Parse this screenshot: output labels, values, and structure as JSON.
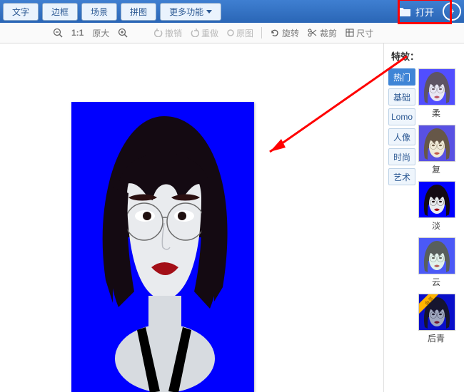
{
  "nav": {
    "tabs": [
      "文字",
      "边框",
      "场景",
      "拼图"
    ],
    "more": "更多功能",
    "open": "打开"
  },
  "toolbar": {
    "zoom": "1:1",
    "zoom_label": "原大",
    "undo": "撤销",
    "redo": "重做",
    "orig": "原图",
    "rotate": "旋转",
    "crop": "裁剪",
    "resize": "尺寸"
  },
  "effects": {
    "title": "特效：",
    "categories": [
      "热门",
      "基础",
      "Lomo",
      "人像",
      "时尚",
      "艺术"
    ],
    "thumbs": [
      {
        "label": "柔",
        "tint": "#e8e0ff"
      },
      {
        "label": "复",
        "tint": "#ffe8b0"
      },
      {
        "label": "淡",
        "tint": "#ffffff"
      },
      {
        "label": "云",
        "tint": "#d8ffe8"
      },
      {
        "label": "后青",
        "tint": "#1a2a66",
        "badge": "会员"
      }
    ]
  }
}
